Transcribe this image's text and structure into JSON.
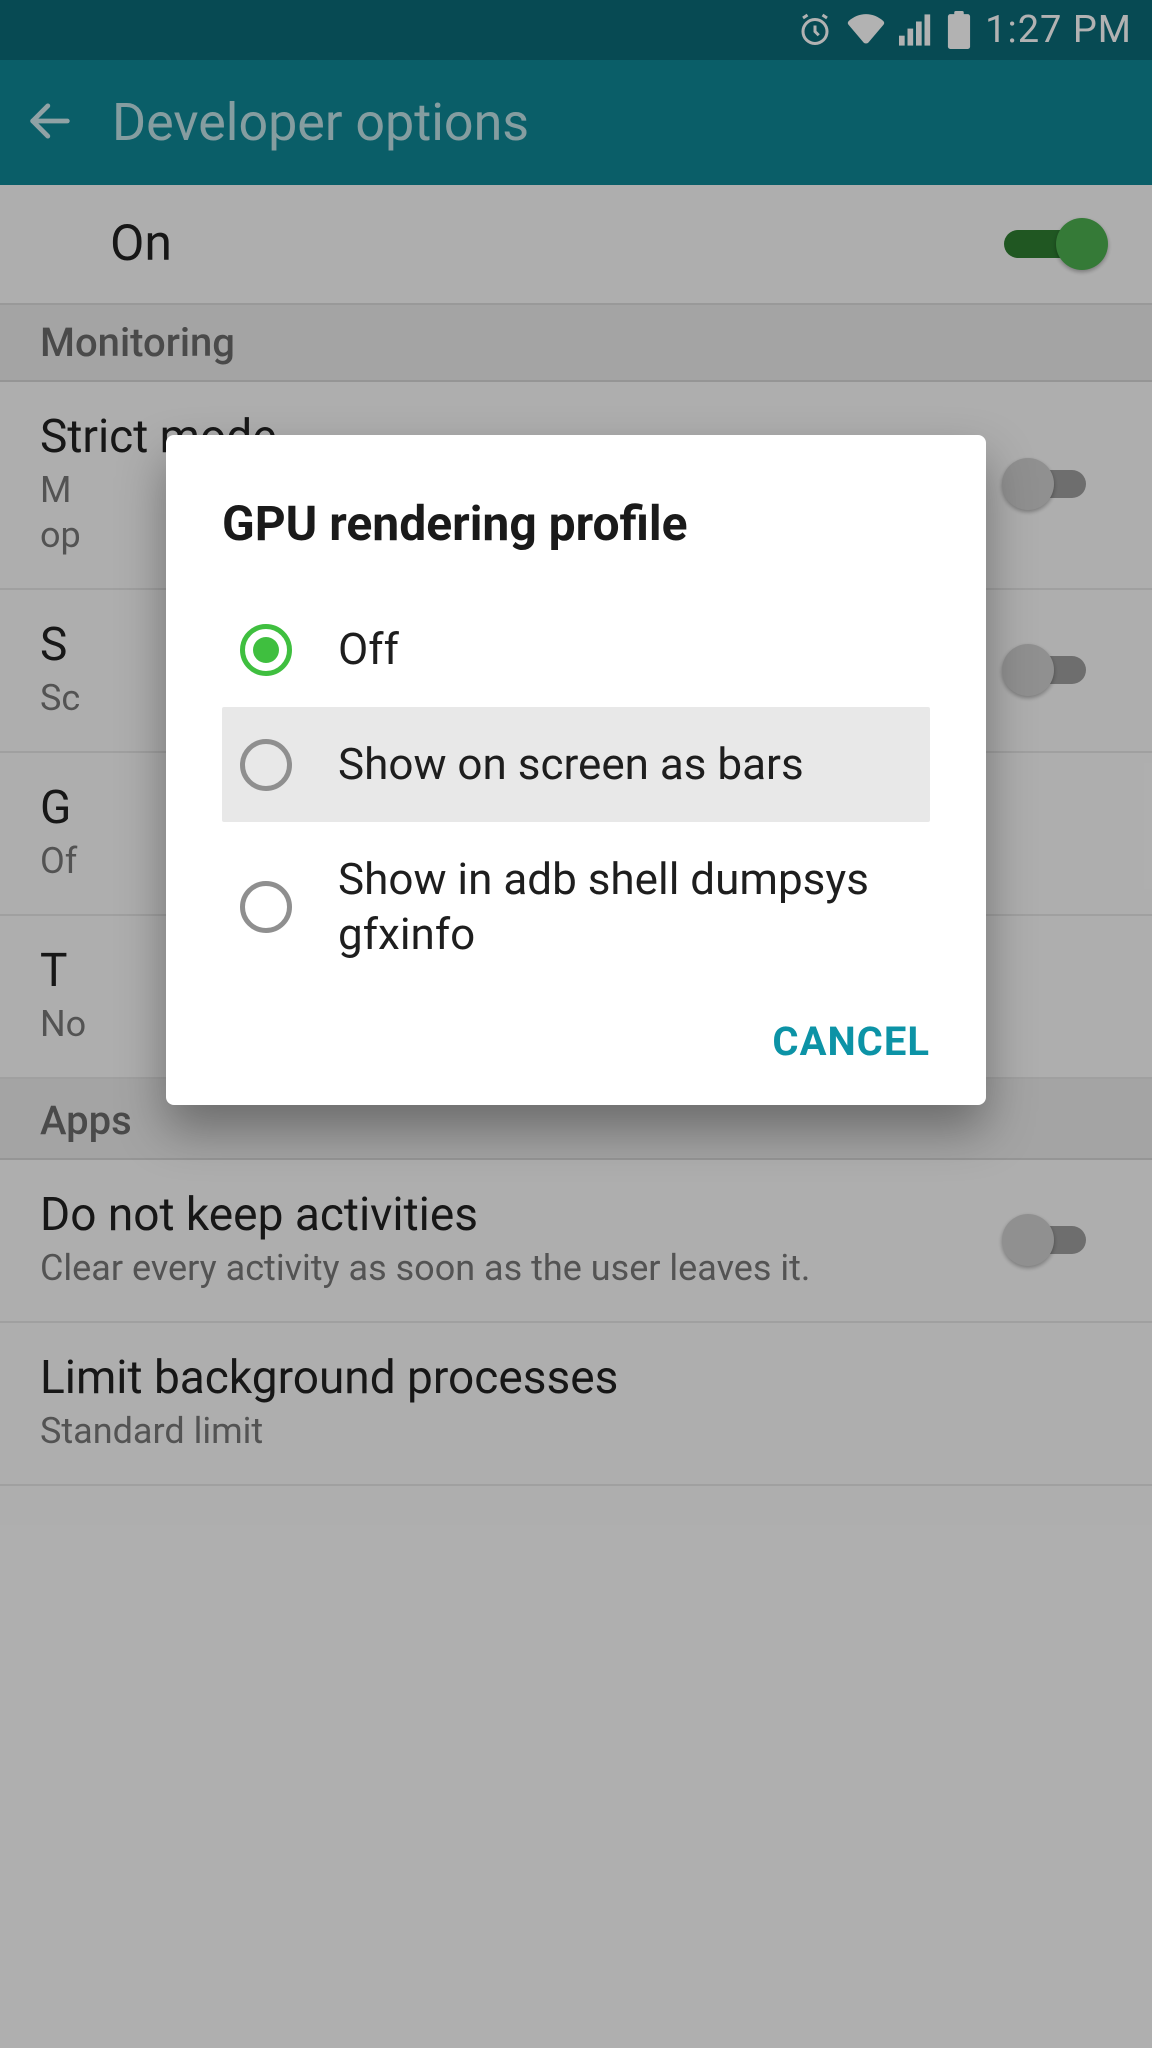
{
  "status": {
    "time": "1:27 PM"
  },
  "appbar": {
    "title": "Developer options"
  },
  "master": {
    "label": "On",
    "enabled": true
  },
  "sections": {
    "monitoring": {
      "header": "Monitoring"
    },
    "apps": {
      "header": "Apps"
    }
  },
  "items": {
    "strict_mode": {
      "title": "Strict mode",
      "sub_prefix": "M",
      "sub_line2_prefix": "op"
    },
    "show_cpu": {
      "title_prefix": "S",
      "sub_prefix": "Sc"
    },
    "gpu_profile": {
      "title_prefix": "G",
      "sub_prefix": "Of"
    },
    "transition": {
      "title_prefix": "T",
      "sub_prefix": "No"
    },
    "no_keep": {
      "title": "Do not keep activities",
      "sub": "Clear every activity as soon as the user leaves it."
    },
    "limit_bg": {
      "title": "Limit background processes",
      "sub": "Standard limit"
    }
  },
  "dialog": {
    "title": "GPU rendering profile",
    "options": [
      {
        "label": "Off",
        "selected": true,
        "highlight": false
      },
      {
        "label": "Show on screen as bars",
        "selected": false,
        "highlight": true
      },
      {
        "label": "Show in adb shell dumpsys gfxinfo",
        "selected": false,
        "highlight": false
      }
    ],
    "cancel": "CANCEL"
  }
}
